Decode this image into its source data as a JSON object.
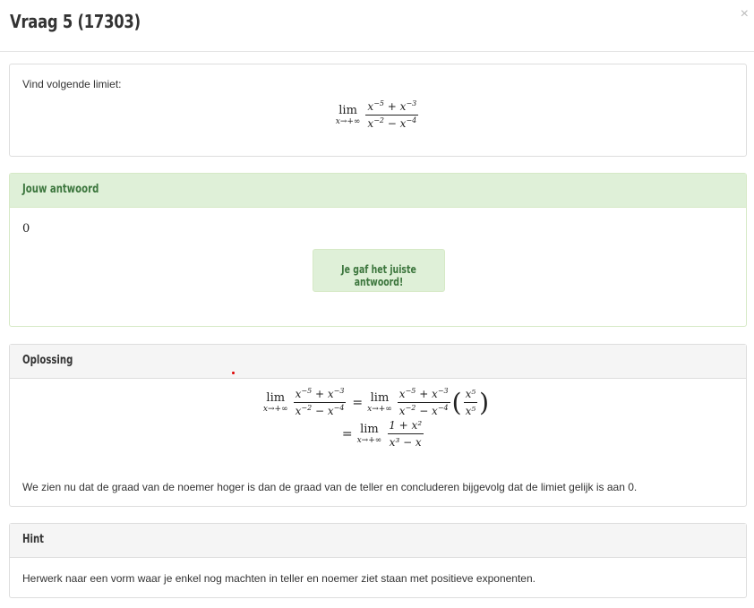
{
  "modal": {
    "title": "Vraag 5 (17303)",
    "close": "×"
  },
  "question": {
    "prompt": "Vind volgende limiet:",
    "lim": "lim",
    "sub": "x→+∞",
    "num": "x⁻⁵ + x⁻³",
    "den": "x⁻² − x⁻⁴"
  },
  "answer": {
    "heading": "Jouw antwoord",
    "value": "0",
    "feedback": "Je gaf het juiste antwoord!"
  },
  "solution": {
    "heading": "Oplossing",
    "eq": "=",
    "step1_factor_num": "x⁵",
    "step1_factor_den": "x⁵",
    "step2_num": "1 + x²",
    "step2_den": "x³ − x",
    "text": "We zien nu dat de graad van de noemer hoger is dan de graad van de teller en concluderen bijgevolg dat de limiet gelijk is aan 0."
  },
  "hint": {
    "heading": "Hint",
    "text": "Herwerk naar een vorm waar je enkel nog machten in teller en noemer ziet staan met positieve exponenten."
  },
  "colors": {
    "success_bg": "#dff0d8",
    "success_text": "#3c763d",
    "panel_border": "#dddddd"
  }
}
